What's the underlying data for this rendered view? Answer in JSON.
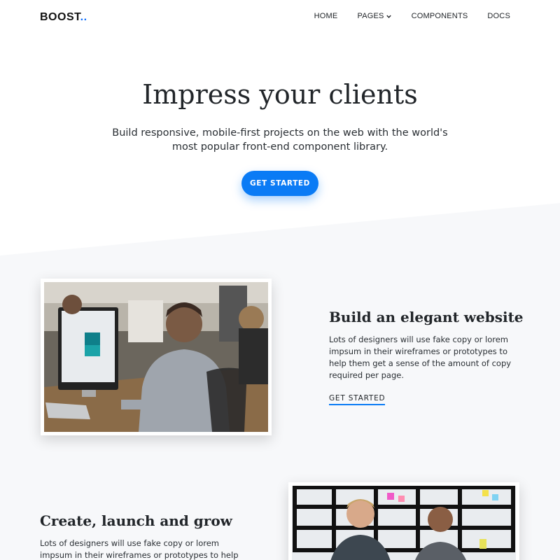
{
  "nav": {
    "brand": "BOOST",
    "brand_dots": "..",
    "links": [
      "HOME",
      "PAGES",
      "COMPONENTS",
      "DOCS"
    ]
  },
  "hero": {
    "title": "Impress your clients",
    "subtitle": "Build responsive, mobile-first projects on the web with the world's most popular front-end component library.",
    "cta": "GET STARTED"
  },
  "features": [
    {
      "title": "Build an elegant website",
      "text": "Lots of designers will use fake copy or lorem impsum in their wireframes or prototypes to help them get a sense of the amount of copy required per page.",
      "link": "GET STARTED"
    },
    {
      "title": "Create, launch and grow",
      "text": "Lots of designers will use fake copy or lorem impsum in their wireframes or prototypes to help"
    }
  ],
  "colors": {
    "accent": "#0a7bf5",
    "section_bg": "#f7f8fa",
    "text": "#212529"
  }
}
